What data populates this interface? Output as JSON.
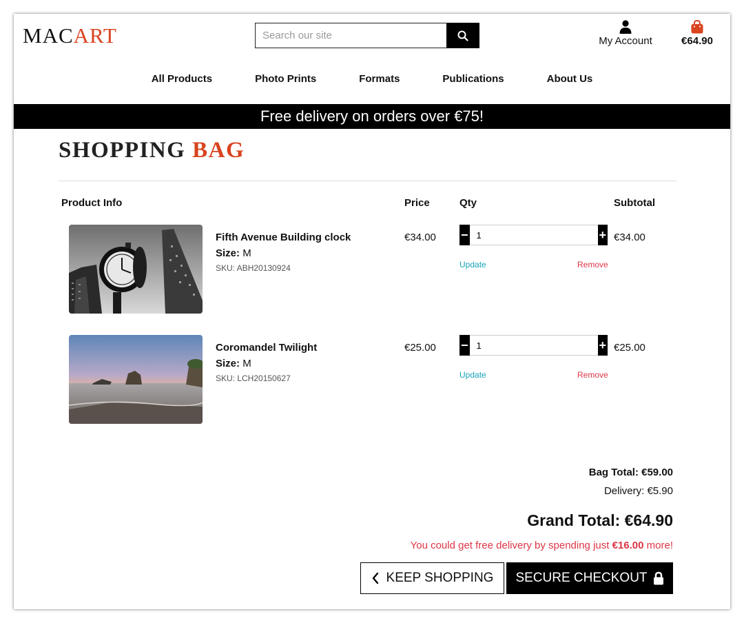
{
  "header": {
    "logo_part1": "MAC",
    "logo_part2": "ART",
    "search_placeholder": "Search our site",
    "account_label": "My Account",
    "bag_total": "€64.90",
    "brand_color": "#d9431f"
  },
  "nav": {
    "items": [
      "All Products",
      "Photo Prints",
      "Formats",
      "Publications",
      "About Us"
    ]
  },
  "banner": {
    "text": "Free delivery on orders over €75!"
  },
  "page": {
    "title_part1": "SHOPPING",
    "title_part2": "BAG"
  },
  "table": {
    "headers": {
      "product": "Product Info",
      "price": "Price",
      "qty": "Qty",
      "subtotal": "Subtotal"
    },
    "rows": [
      {
        "name": "Fifth Avenue Building clock",
        "size_label": "Size:",
        "size": "M",
        "sku": "SKU: ABH20130924",
        "price": "€34.00",
        "qty": "1",
        "subtotal": "€34.00",
        "update": "Update",
        "remove": "Remove",
        "image": "black-and-white-clock-and-flatiron-photo"
      },
      {
        "name": "Coromandel Twilight",
        "size_label": "Size:",
        "size": "M",
        "sku": "SKU: LCH20150627",
        "price": "€25.00",
        "qty": "1",
        "subtotal": "€25.00",
        "update": "Update",
        "remove": "Remove",
        "image": "twilight-beach-rock-photo"
      }
    ]
  },
  "totals": {
    "bag_total": "Bag Total: €59.00",
    "delivery": "Delivery: €5.90",
    "grand_total": "Grand Total: €64.90",
    "promo_prefix": "You could get free delivery by spending just",
    "promo_amount": "€16.00",
    "promo_suffix": "more!"
  },
  "buttons": {
    "keep_shopping": "KEEP SHOPPING",
    "secure_checkout": "SECURE CHECKOUT"
  }
}
